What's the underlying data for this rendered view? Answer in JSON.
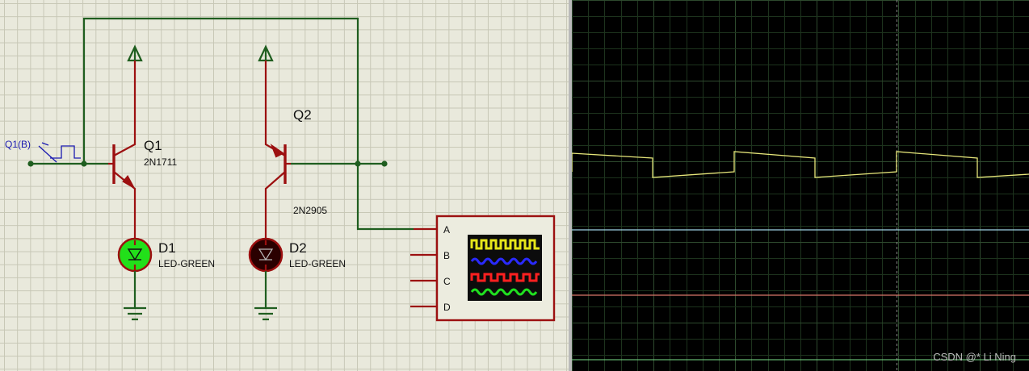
{
  "schematic": {
    "generator_label": "Q1(B)",
    "q1": {
      "ref": "Q1",
      "part": "2N1711"
    },
    "q2": {
      "ref": "Q2",
      "part": "2N2905"
    },
    "d1": {
      "ref": "D1",
      "part": "LED-GREEN",
      "state": "on"
    },
    "d2": {
      "ref": "D2",
      "part": "LED-GREEN",
      "state": "off"
    },
    "scope_inputs": [
      "A",
      "B",
      "C",
      "D"
    ]
  },
  "colors": {
    "wire": "#1f5e1f",
    "component": "#9c1010",
    "led_on": "#22e01a",
    "label_blue": "#1a1ab0",
    "trace_a": "#e6e67a",
    "trace_b": "#9fd4e6",
    "trace_c": "#d9766a",
    "trace_d": "#7adf8a"
  },
  "watermark": "CSDN @* Li Ning"
}
